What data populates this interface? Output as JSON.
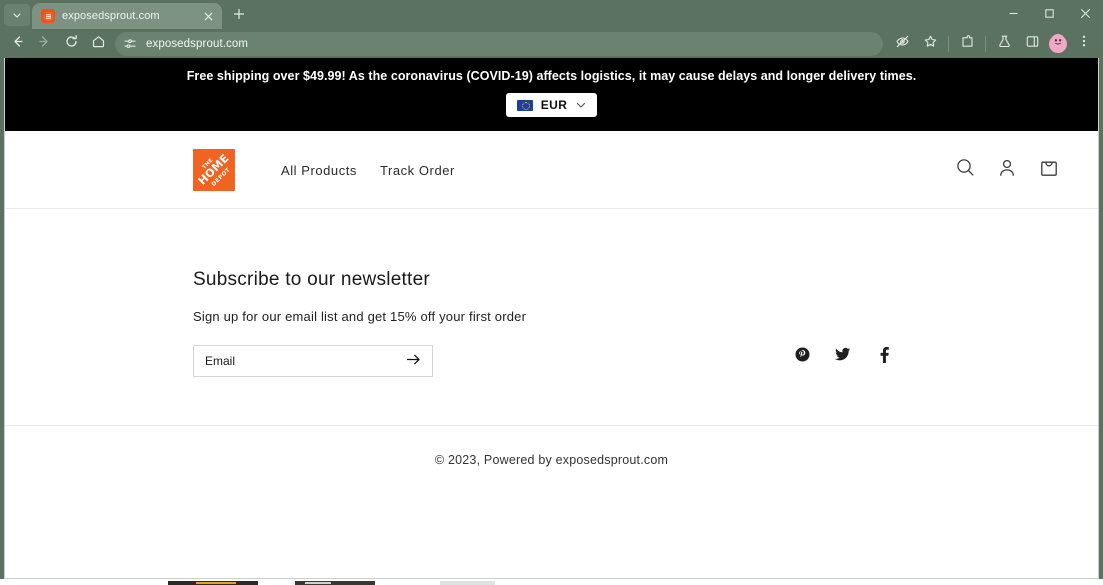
{
  "browser": {
    "tab": {
      "title": "exposedsprout.com",
      "favicon_icon": "site-favicon",
      "close_icon": "close-icon"
    },
    "tab_search_icon": "chevron-down-icon",
    "new_tab_icon": "plus-icon",
    "window_controls": {
      "minimize_icon": "minimize-icon",
      "maximize_icon": "maximize-icon",
      "close_icon": "close-icon"
    },
    "toolbar": {
      "back_icon": "back-arrow-icon",
      "forward_icon": "forward-arrow-icon",
      "reload_icon": "reload-icon",
      "home_icon": "home-icon",
      "site_settings_icon": "tune-icon",
      "url": "exposedsprout.com",
      "tracking_protection_icon": "eye-slash-icon",
      "bookmark_icon": "star-icon",
      "extensions_icon": "extensions-icon",
      "labs_icon": "flask-icon",
      "side_panel_icon": "side-panel-icon",
      "profile_icon": "avatar-icon",
      "menu_icon": "three-dots-icon"
    },
    "colors": {
      "chrome_bg": "#5c7260",
      "tab_active": "#7d9281",
      "omnibox": "#6c8271"
    }
  },
  "page": {
    "announcement": {
      "text": "Free shipping over $49.99! As the coronavirus (COVID-19) affects logistics, it may cause delays and longer delivery times.",
      "bg_color": "#000000",
      "currency": {
        "code": "EUR",
        "flag_icon": "eu-flag-icon",
        "chevron_icon": "chevron-down-icon"
      }
    },
    "header": {
      "logo_name": "home-depot-logo",
      "logo_color": "#f06321",
      "logo_lines": [
        "THE",
        "HOME",
        "DEPOT"
      ],
      "nav": [
        {
          "label": "All Products"
        },
        {
          "label": "Track Order"
        }
      ],
      "icons": [
        {
          "name": "search-icon"
        },
        {
          "name": "account-icon"
        },
        {
          "name": "cart-icon"
        }
      ]
    },
    "newsletter": {
      "title": "Subscribe to our newsletter",
      "subtitle": "Sign up for our email list and get 15% off your first order",
      "email_placeholder": "Email",
      "email_value": "",
      "submit_icon": "arrow-right-icon"
    },
    "socials": [
      {
        "name": "pinterest-icon",
        "label": "P"
      },
      {
        "name": "twitter-icon",
        "label": "t"
      },
      {
        "name": "facebook-icon",
        "label": "f"
      }
    ],
    "footer": {
      "copyright": "© 2023, Powered by exposedsprout.com"
    }
  }
}
